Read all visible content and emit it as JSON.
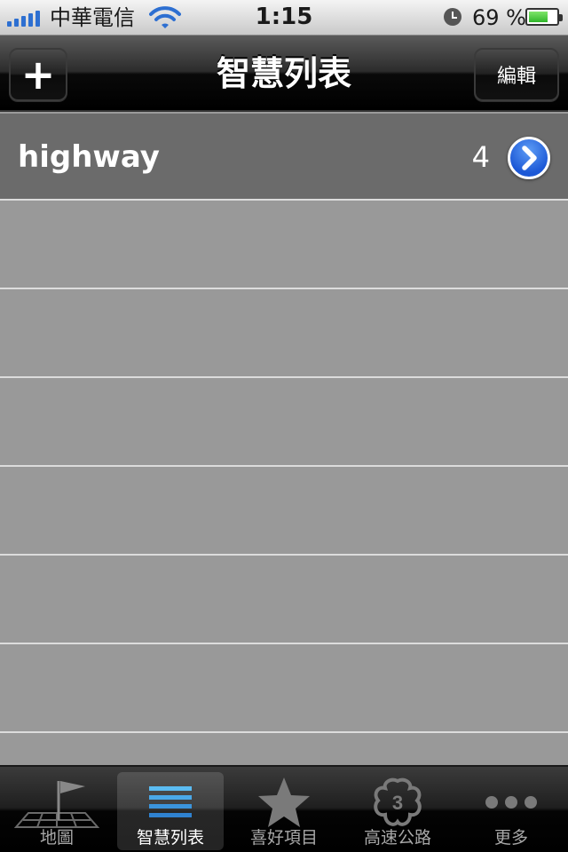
{
  "status_bar": {
    "carrier": "中華電信",
    "time": "1:15",
    "battery_percent": "69 %",
    "battery_level": 0.69
  },
  "nav": {
    "add_label": "+",
    "title": "智慧列表",
    "edit_label": "編輯"
  },
  "list": {
    "items": [
      {
        "name": "highway",
        "count": "4"
      }
    ]
  },
  "tabs": [
    {
      "label": "地圖",
      "icon": "map-flag-icon"
    },
    {
      "label": "智慧列表",
      "icon": "list-icon"
    },
    {
      "label": "喜好項目",
      "icon": "star-icon"
    },
    {
      "label": "高速公路",
      "icon": "highway-shield-icon"
    },
    {
      "label": "更多",
      "icon": "more-dots-icon"
    }
  ],
  "colors": {
    "accent_blue": "#2d6fd1",
    "active_list_icon": "#4aa8e8"
  }
}
